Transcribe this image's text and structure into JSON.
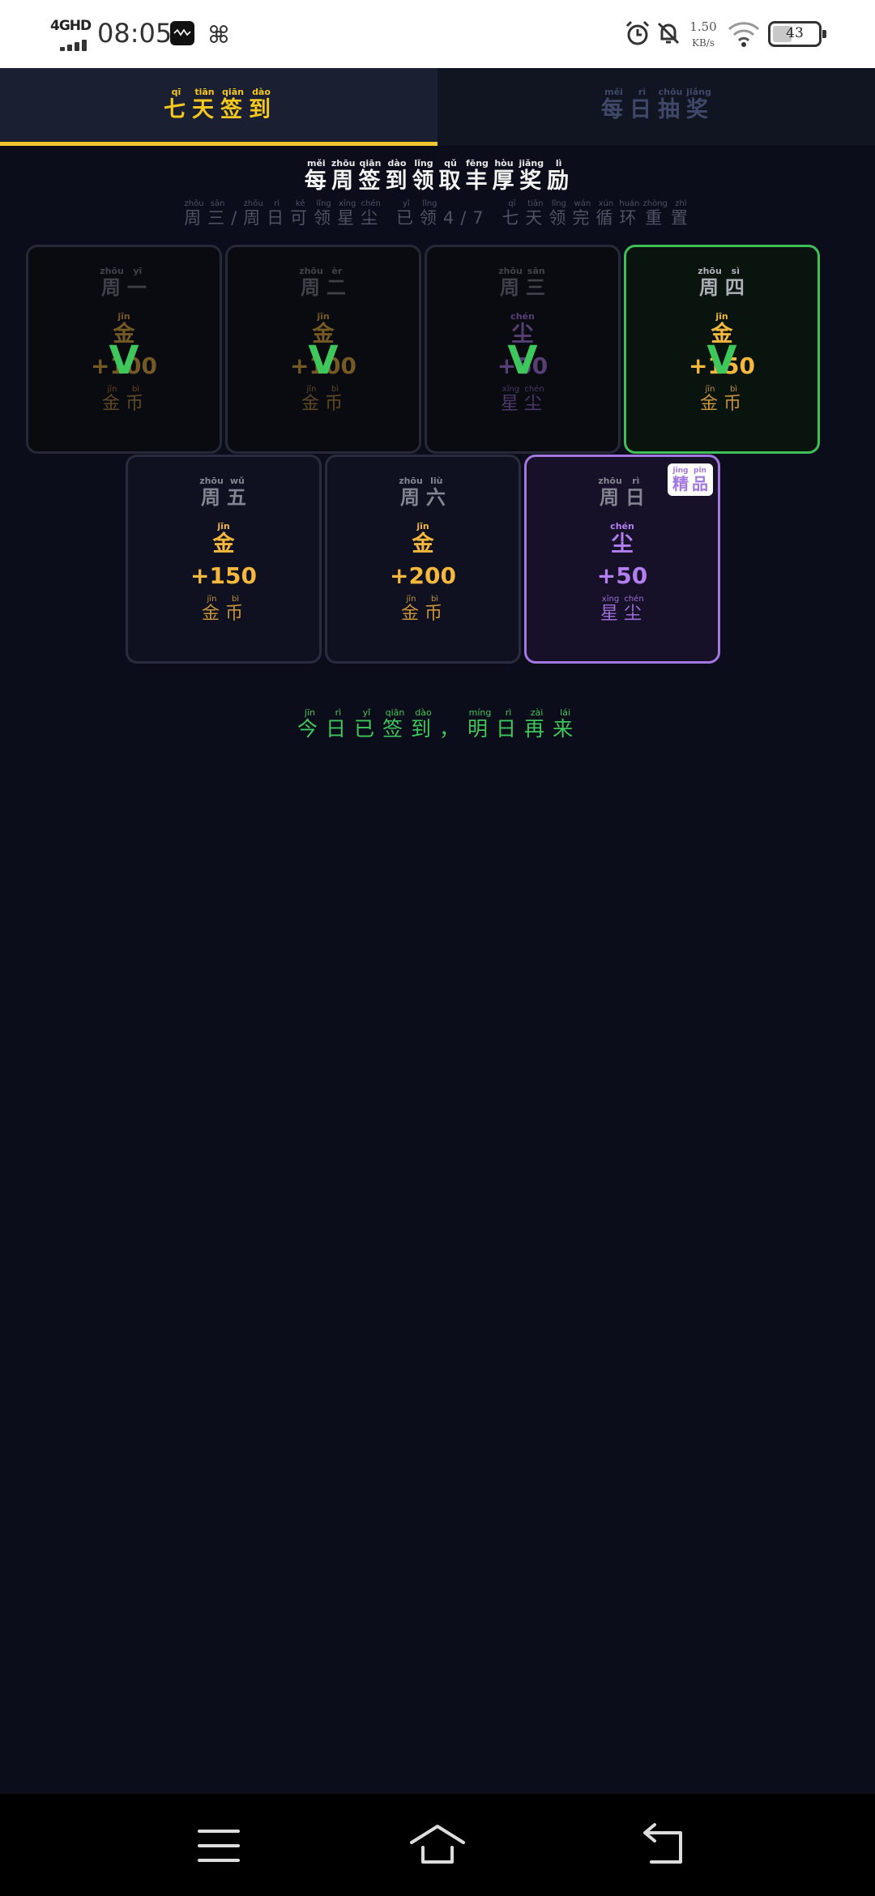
{
  "status_bar": {
    "network": "4GHD",
    "time": "08:05",
    "net_speed_value": "1.50",
    "net_speed_unit": "KB/s",
    "battery": "43",
    "battery_level": 0.43
  },
  "tabs": [
    {
      "chars": [
        {
          "c": "七",
          "py": "qī"
        },
        {
          "c": "天",
          "py": "tiān"
        },
        {
          "c": "签",
          "py": "qiān"
        },
        {
          "c": "到",
          "py": "dào"
        }
      ],
      "active": true
    },
    {
      "chars": [
        {
          "c": "每",
          "py": "měi"
        },
        {
          "c": "日",
          "py": "rì"
        },
        {
          "c": "抽",
          "py": "chōu"
        },
        {
          "c": "奖",
          "py": "jiǎng"
        }
      ],
      "active": false
    }
  ],
  "headline": [
    {
      "c": "每",
      "py": "měi"
    },
    {
      "c": "周",
      "py": "zhōu"
    },
    {
      "c": "签",
      "py": "qiān"
    },
    {
      "c": "到",
      "py": "dào"
    },
    {
      "c": "领",
      "py": "lǐng"
    },
    {
      "c": "取",
      "py": "qǔ"
    },
    {
      "c": "丰",
      "py": "fēng"
    },
    {
      "c": "厚",
      "py": "hòu"
    },
    {
      "c": "奖",
      "py": "jiǎng"
    },
    {
      "c": "励",
      "py": "lì"
    }
  ],
  "subline": [
    {
      "c": "周",
      "py": "zhōu"
    },
    {
      "c": "三",
      "py": "sān"
    },
    {
      "c": "/",
      "py": ""
    },
    {
      "c": "周",
      "py": "zhōu"
    },
    {
      "c": "日",
      "py": "rì"
    },
    {
      "c": "可",
      "py": "kě"
    },
    {
      "c": "领",
      "py": "lǐng"
    },
    {
      "c": "星",
      "py": "xīng"
    },
    {
      "c": "尘",
      "py": "chén"
    },
    {
      "c": " ",
      "py": ""
    },
    {
      "c": "已",
      "py": "yǐ"
    },
    {
      "c": "领",
      "py": "lǐng"
    },
    {
      "c": "4",
      "py": ""
    },
    {
      "c": "/",
      "py": ""
    },
    {
      "c": "7",
      "py": ""
    },
    {
      "c": " ",
      "py": ""
    },
    {
      "c": "七",
      "py": "qī"
    },
    {
      "c": "天",
      "py": "tiān"
    },
    {
      "c": "领",
      "py": "lǐng"
    },
    {
      "c": "完",
      "py": "wán"
    },
    {
      "c": "循",
      "py": "xún"
    },
    {
      "c": "环",
      "py": "huán"
    },
    {
      "c": "重",
      "py": "zhòng"
    },
    {
      "c": "置",
      "py": "zhì"
    }
  ],
  "days": [
    {
      "day": [
        {
          "c": "周",
          "py": "zhōu"
        },
        {
          "c": "一",
          "py": "yī"
        }
      ],
      "type": "gold",
      "icon": {
        "c": "金",
        "py": "jīn"
      },
      "amount": "+100",
      "name": [
        {
          "c": "金",
          "py": "jīn"
        },
        {
          "c": "币",
          "py": "bì"
        }
      ],
      "state": "claimed"
    },
    {
      "day": [
        {
          "c": "周",
          "py": "zhōu"
        },
        {
          "c": "二",
          "py": "èr"
        }
      ],
      "type": "gold",
      "icon": {
        "c": "金",
        "py": "jīn"
      },
      "amount": "+100",
      "name": [
        {
          "c": "金",
          "py": "jīn"
        },
        {
          "c": "币",
          "py": "bì"
        }
      ],
      "state": "claimed"
    },
    {
      "day": [
        {
          "c": "周",
          "py": "zhōu"
        },
        {
          "c": "三",
          "py": "sān"
        }
      ],
      "type": "dust",
      "icon": {
        "c": "尘",
        "py": "chén"
      },
      "amount": "+50",
      "name": [
        {
          "c": "星",
          "py": "xīng"
        },
        {
          "c": "尘",
          "py": "chén"
        }
      ],
      "state": "claimed"
    },
    {
      "day": [
        {
          "c": "周",
          "py": "zhōu"
        },
        {
          "c": "四",
          "py": "sì"
        }
      ],
      "type": "gold",
      "icon": {
        "c": "金",
        "py": "jīn"
      },
      "amount": "+150",
      "name": [
        {
          "c": "金",
          "py": "jīn"
        },
        {
          "c": "币",
          "py": "bì"
        }
      ],
      "state": "today"
    },
    {
      "day": [
        {
          "c": "周",
          "py": "zhōu"
        },
        {
          "c": "五",
          "py": "wǔ"
        }
      ],
      "type": "gold",
      "icon": {
        "c": "金",
        "py": "jīn"
      },
      "amount": "+150",
      "name": [
        {
          "c": "金",
          "py": "jīn"
        },
        {
          "c": "币",
          "py": "bì"
        }
      ],
      "state": "upcoming"
    },
    {
      "day": [
        {
          "c": "周",
          "py": "zhōu"
        },
        {
          "c": "六",
          "py": "liù"
        }
      ],
      "type": "gold",
      "icon": {
        "c": "金",
        "py": "jīn"
      },
      "amount": "+200",
      "name": [
        {
          "c": "金",
          "py": "jīn"
        },
        {
          "c": "币",
          "py": "bì"
        }
      ],
      "state": "upcoming"
    },
    {
      "day": [
        {
          "c": "周",
          "py": "zhōu"
        },
        {
          "c": "日",
          "py": "rì"
        }
      ],
      "type": "dust",
      "icon": {
        "c": "尘",
        "py": "chén"
      },
      "amount": "+50",
      "name": [
        {
          "c": "星",
          "py": "xīng"
        },
        {
          "c": "尘",
          "py": "chén"
        }
      ],
      "state": "premium",
      "badge": [
        {
          "c": "精",
          "py": "jīng"
        },
        {
          "c": "品",
          "py": "pǐn"
        }
      ]
    }
  ],
  "claimed_mark": "V",
  "status_message": [
    {
      "c": "今",
      "py": "jīn"
    },
    {
      "c": "日",
      "py": "rì"
    },
    {
      "c": "已",
      "py": "yǐ"
    },
    {
      "c": "签",
      "py": "qiān"
    },
    {
      "c": "到",
      "py": "dào"
    },
    {
      "c": "，",
      "py": ""
    },
    {
      "c": "明",
      "py": "míng"
    },
    {
      "c": "日",
      "py": "rì"
    },
    {
      "c": "再",
      "py": "zài"
    },
    {
      "c": "来",
      "py": "lái"
    }
  ],
  "colors": {
    "background": "#0b0d1a",
    "accent_gold": "#f6c81f",
    "reward_gold": "#f5b83d",
    "reward_dust": "#b37ff0",
    "success_green": "#3ec75a",
    "premium_border": "#a377e2"
  },
  "icons": {
    "nav_menu": "menu-icon",
    "nav_home": "home-icon",
    "nav_back": "back-icon",
    "status_alarm": "alarm-icon",
    "status_mute": "bell-off-icon",
    "status_wifi": "wifi-icon"
  }
}
